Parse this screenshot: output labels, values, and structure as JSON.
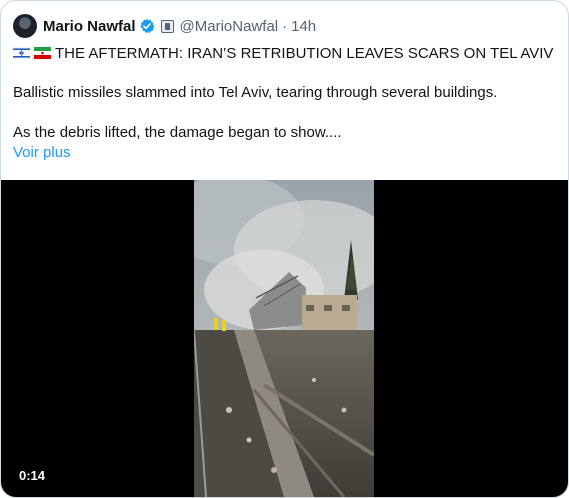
{
  "tweet": {
    "author_name": "Mario Nawfal",
    "handle": "@MarioNawfal",
    "separator": "·",
    "time": "14h",
    "headline": "THE AFTERMATH: IRAN’S RETRIBUTION LEAVES SCARS ON TEL AVIV",
    "paragraph1": "Ballistic missiles slammed into Tel Aviv, tearing through several buildings.",
    "paragraph2": "As the debris lifted, the damage began to show....",
    "show_more": "Voir plus"
  },
  "media": {
    "duration": "0:14"
  },
  "icons": {
    "verified": "verified-badge-icon",
    "affiliate": "affiliate-badge-icon",
    "flag1": "israel-flag-icon",
    "flag2": "iran-flag-icon"
  },
  "colors": {
    "link": "#1d9bf0",
    "secondary_text": "#536471",
    "border": "#cfd9de"
  }
}
